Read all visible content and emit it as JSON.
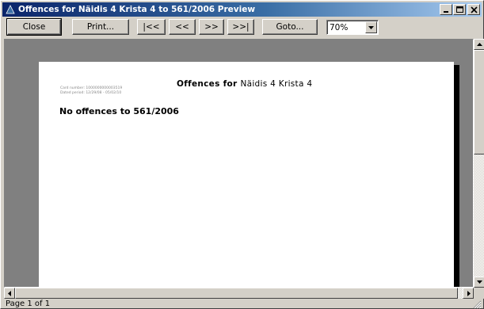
{
  "window": {
    "title": "Offences for Näidis 4 Krista 4 to 561/2006 Preview"
  },
  "toolbar": {
    "close_label": "Close",
    "print_label": "Print...",
    "first_label": "|<<",
    "prev_label": "<<",
    "next_label": ">>",
    "last_label": ">>|",
    "goto_label": "Goto...",
    "zoom_value": "70%"
  },
  "report": {
    "title_prefix": "Offences for",
    "title_name": "Näidis 4 Krista 4",
    "card_number": "Card number: 1000000000003519",
    "dated_period": "Dated period: 12/29/08 - 05/02/10",
    "message": "No offences to 561/2006"
  },
  "status": {
    "page_text": "Page 1 of 1"
  },
  "colors": {
    "titlebar_start": "#0a246a",
    "titlebar_end": "#a6caf0",
    "preview_background": "#808080",
    "window_face": "#d4d0c8"
  }
}
